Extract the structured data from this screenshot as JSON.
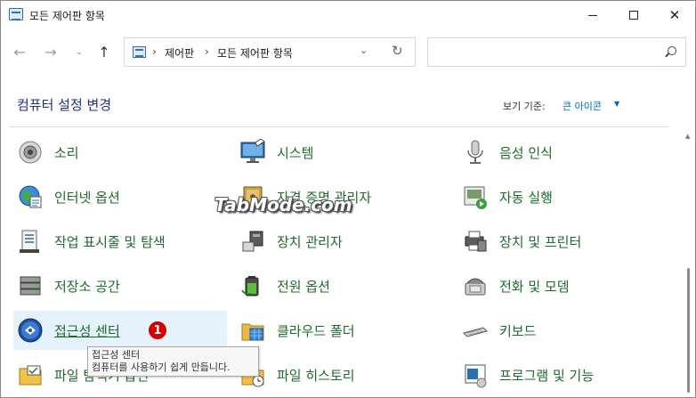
{
  "window": {
    "title": "모든 제어판 항목",
    "controls": {
      "minimize": "minimize-icon",
      "maximize": "maximize-icon",
      "close": "✕"
    }
  },
  "nav": {
    "back": "←",
    "forward": "→",
    "recent": "⌄",
    "up": "↑",
    "address_crumbs": [
      "제어판",
      "모든 제어판 항목"
    ],
    "separator": "›",
    "dropdown": "⌄",
    "refresh": "↻",
    "search_placeholder": ""
  },
  "header": {
    "title": "컴퓨터 설정 변경",
    "view_by_label": "보기 기준:",
    "view_by_value": "큰 아이콘",
    "view_by_caret": "▼"
  },
  "items": [
    {
      "label": "소리",
      "icon": "speaker-icon"
    },
    {
      "label": "시스템",
      "icon": "monitor-icon"
    },
    {
      "label": "음성 인식",
      "icon": "microphone-icon"
    },
    {
      "label": "인터넷 옵션",
      "icon": "globe-icon"
    },
    {
      "label": "자격 증명 관리자",
      "icon": "credential-vault-icon"
    },
    {
      "label": "자동 실행",
      "icon": "autoplay-icon"
    },
    {
      "label": "작업 표시줄 및 탐색",
      "icon": "taskbar-icon"
    },
    {
      "label": "장치 관리자",
      "icon": "device-manager-icon"
    },
    {
      "label": "장치 및 프린터",
      "icon": "printer-icon"
    },
    {
      "label": "저장소 공간",
      "icon": "storage-spaces-icon"
    },
    {
      "label": "전원 옵션",
      "icon": "power-options-icon"
    },
    {
      "label": "전화 및 모뎀",
      "icon": "phone-modem-icon"
    },
    {
      "label": "접근성 센터",
      "icon": "ease-of-access-icon"
    },
    {
      "label": "클라우드 폴더",
      "icon": "work-folders-icon"
    },
    {
      "label": "키보드",
      "icon": "keyboard-icon"
    },
    {
      "label": "파일 탐색기 옵션",
      "icon": "folder-options-icon"
    },
    {
      "label": "파일 히스토리",
      "icon": "file-history-icon"
    },
    {
      "label": "프로그램 및 기능",
      "icon": "programs-features-icon"
    }
  ],
  "badge": "1",
  "tooltip": {
    "title": "접근성 센터",
    "description": "컴퓨터를 사용하기 쉽게 만듭니다."
  },
  "watermark": "TabMode.com",
  "colors": {
    "link_green": "#1c6b28",
    "heading_blue": "#1e3287",
    "hover_bg": "#e5f1fb",
    "badge_red": "#d40000"
  }
}
